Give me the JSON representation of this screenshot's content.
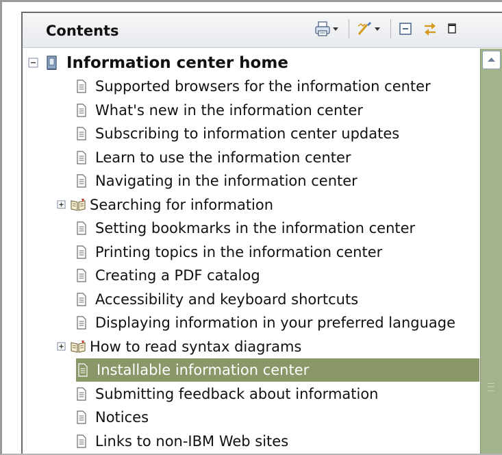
{
  "panel": {
    "title": "Contents"
  },
  "toolbar": {
    "icons": [
      "print-icon",
      "dropdown-arrow",
      "highlight-icon",
      "dropdown-arrow",
      "collapse-all-icon",
      "link-with-contents-icon",
      "maximize-icon"
    ]
  },
  "tree": {
    "root": {
      "label": "Information center home",
      "expanded": true,
      "expander": "⊟"
    },
    "items": [
      {
        "label": "Supported browsers for the information center",
        "type": "topic"
      },
      {
        "label": "What's new in the information center",
        "type": "topic"
      },
      {
        "label": "Subscribing to information center updates",
        "type": "topic"
      },
      {
        "label": "Learn to use the information center",
        "type": "topic"
      },
      {
        "label": "Navigating in the information center",
        "type": "topic"
      },
      {
        "label": "Searching for information",
        "type": "book",
        "expander": "⊞"
      },
      {
        "label": "Setting bookmarks in the information center",
        "type": "topic"
      },
      {
        "label": "Printing topics in the information center",
        "type": "topic"
      },
      {
        "label": "Creating a PDF catalog",
        "type": "topic"
      },
      {
        "label": "Accessibility and keyboard shortcuts",
        "type": "topic"
      },
      {
        "label": "Displaying information in your preferred language",
        "type": "topic"
      },
      {
        "label": "How to read syntax diagrams",
        "type": "book",
        "expander": "⊞"
      },
      {
        "label": "Installable information center",
        "type": "topic",
        "selected": true
      },
      {
        "label": "Submitting feedback about information",
        "type": "topic"
      },
      {
        "label": "Notices",
        "type": "topic"
      },
      {
        "label": "Links to non-IBM Web sites",
        "type": "topic"
      }
    ]
  },
  "colors": {
    "selection": "#8a9768",
    "scrollbar": "#a3b48c"
  }
}
